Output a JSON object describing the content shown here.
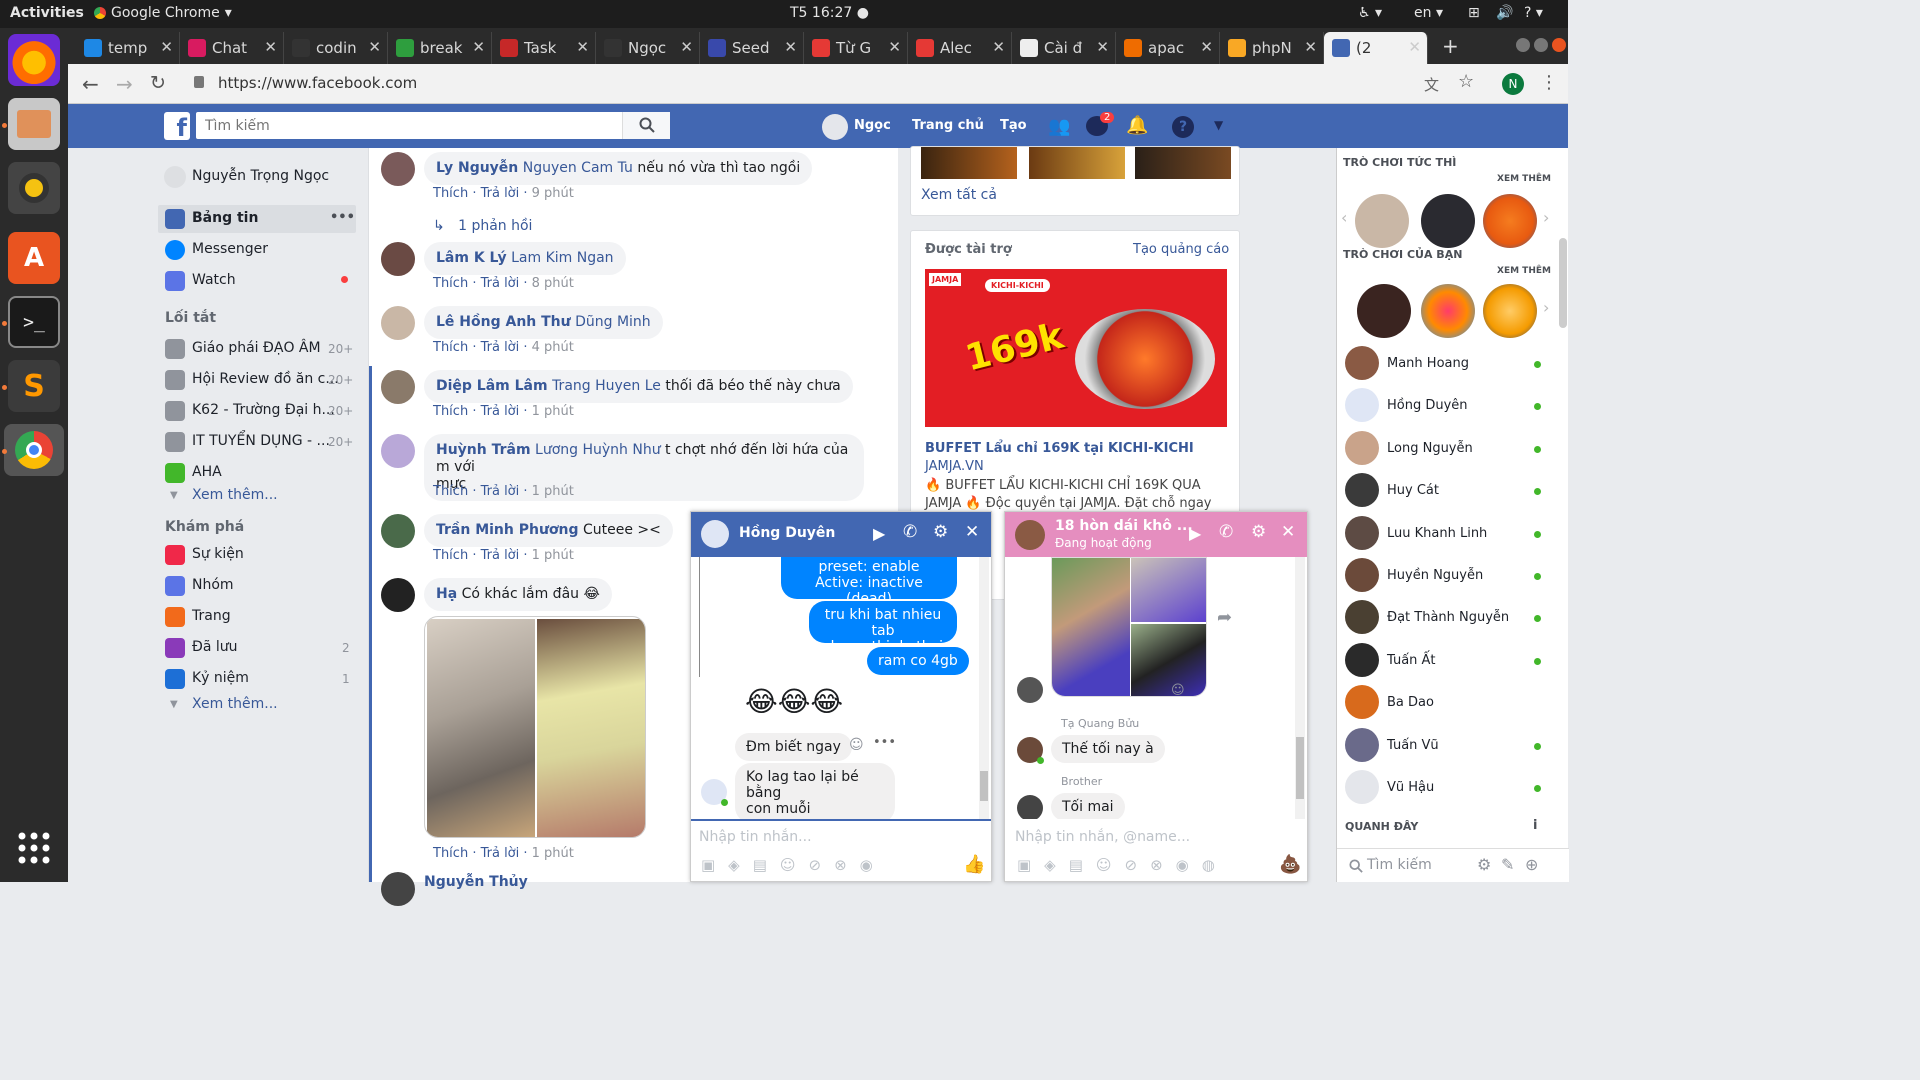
{
  "os": {
    "activities": "Activities",
    "app_menu": "Google Chrome",
    "clock": "T5 16:27",
    "lang": "en"
  },
  "tabs": [
    {
      "label": "temp",
      "color": "#1e88e5"
    },
    {
      "label": "Chat",
      "color": "#d81b60"
    },
    {
      "label": "codin",
      "color": "#333333"
    },
    {
      "label": "break",
      "color": "#2e9e3e"
    },
    {
      "label": "Task",
      "color": "#c62828"
    },
    {
      "label": "Ngọc",
      "color": "#333333"
    },
    {
      "label": "Seed",
      "color": "#3949ab"
    },
    {
      "label": "Từ G",
      "color": "#e53935"
    },
    {
      "label": "Alec",
      "color": "#e53935"
    },
    {
      "label": "Cài đ",
      "color": "#eeeeee"
    },
    {
      "label": "apac",
      "color": "#ef6c00"
    },
    {
      "label": "phpN",
      "color": "#f9a825"
    },
    {
      "label": "(2",
      "color": "#4267b2"
    }
  ],
  "address": {
    "url": "https://www.facebook.com",
    "profile_initial": "N"
  },
  "fb_header": {
    "search_placeholder": "Tìm kiếm",
    "user": "Ngọc",
    "home": "Trang chủ",
    "create": "Tạo",
    "messages_badge": "2"
  },
  "left_nav": {
    "profile_name": "Nguyễn Trọng Ngọc",
    "main": [
      {
        "label": "Bảng tin",
        "more": "•••"
      },
      {
        "label": "Messenger"
      },
      {
        "label": "Watch"
      }
    ],
    "shortcuts_title": "Lối tắt",
    "shortcuts": [
      {
        "label": "Giáo phái ĐẠO ÂM",
        "count": "20+"
      },
      {
        "label": "Hội Review đồ ăn c...",
        "count": "20+"
      },
      {
        "label": "K62 - Trường Đại h...",
        "count": "20+"
      },
      {
        "label": "IT TUYỂN DỤNG - ...",
        "count": "20+"
      },
      {
        "label": "AHA",
        "count": ""
      }
    ],
    "see_more_1": "Xem thêm...",
    "explore_title": "Khám phá",
    "explore": [
      {
        "label": "Sự kiện",
        "count": ""
      },
      {
        "label": "Nhóm",
        "count": ""
      },
      {
        "label": "Trang",
        "count": ""
      },
      {
        "label": "Đã lưu",
        "count": "2"
      },
      {
        "label": "Kỷ niệm",
        "count": "1"
      }
    ],
    "see_more_2": "Xem thêm..."
  },
  "comments": {
    "like": "Thích",
    "reply": "Trả lời",
    "items": [
      {
        "name": "Ly Nguyễn",
        "tag": "Nguyen Cam Tu",
        "text": " nếu nó vừa thì tao ngồi",
        "time": "9 phút"
      },
      {
        "name": "Lâm K Lý",
        "tag": "Lam Kim Ngan",
        "text": "",
        "time": "8 phút"
      },
      {
        "name": "Lê Hồng Anh Thư",
        "tag": "Dũng Minh",
        "text": "",
        "time": "4 phút"
      },
      {
        "name": "Diệp Lâm Lâm",
        "tag": "Trang Huyen Le",
        "text": " thối đã béo thế này chưa",
        "time": "1 phút"
      },
      {
        "name": "Huỳnh Trâm",
        "tag": "Lương Huỳnh Như",
        "text": " t chợt nhớ đến lời hứa của m với",
        "text2": "mực",
        "time": "1 phút"
      },
      {
        "name": "Trần Minh Phương",
        "tag": "",
        "text": " Cuteee ><",
        "time": "1 phút"
      },
      {
        "name": "Hạ",
        "tag": "",
        "text": " Có khác lắm đâu 😂",
        "time": "1 phút"
      }
    ],
    "replies": "1 phản hồi",
    "next_name": "Nguyễn Thủy"
  },
  "right": {
    "see_all": "Xem tất cả",
    "sponsored": "Được tài trợ",
    "create_ad": "Tạo quảng cáo",
    "ad_title": "BUFFET Lẩu chỉ 169K tại KICHI-KICHI",
    "ad_domain": "JAMJA.VN",
    "ad_text1": "🔥 BUFFET LẨU KICHI-KICHI CHỈ 169K QUA",
    "ad_text2": "JAMJA 🔥 Độc quyền tại JAMJA. Đặt chỗ ngay",
    "ad_price": "169k",
    "ad_brand": "KICHI-KICHI",
    "ad_logo": "JAMJA"
  },
  "sidebar": {
    "instant_games": "TRÒ CHƠI TỨC THÌ",
    "see_more": "XEM THÊM",
    "friends_games": "TRÒ CHƠI CỦA BẠN",
    "friends": [
      {
        "name": "Manh Hoang",
        "online": true,
        "color": "#8a5a44"
      },
      {
        "name": "Hồng Duyên",
        "online": true,
        "color": "#dfe6f5"
      },
      {
        "name": "Long Nguyễn",
        "online": true,
        "color": "#c9a38a"
      },
      {
        "name": "Huy Cát",
        "online": true,
        "color": "#3a3a3a"
      },
      {
        "name": "Luu Khanh Linh",
        "online": true,
        "color": "#5d4b44"
      },
      {
        "name": "Huyền Nguyễn",
        "online": true,
        "color": "#6b4a3a"
      },
      {
        "name": "Đạt Thành Nguyễn",
        "online": true,
        "color": "#4a4032"
      },
      {
        "name": "Tuấn Ất",
        "online": true,
        "color": "#2a2a2a"
      },
      {
        "name": "Ba Dao",
        "online": false,
        "color": "#d86a1c"
      },
      {
        "name": "Tuấn Vũ",
        "online": true,
        "color": "#6a6a8a"
      },
      {
        "name": "Vũ Hậu",
        "online": true,
        "color": "#e4e6eb"
      }
    ],
    "recent": "QUANH ĐÂY",
    "search_placeholder": "Tìm kiếm"
  },
  "chat1": {
    "name": "Hồng Duyên",
    "msgs_me": [
      "preset: enable",
      "Active: inactive (dead)",
      "tru khi bat nhieu tab",
      "chrom thi do thoi",
      "ram co 4gb"
    ],
    "emoji": "😂😂😂",
    "msgs_them": [
      "Đm biết ngay",
      "Ko lag tao lại bé bằng",
      "con muỗi"
    ],
    "input_placeholder": "Nhập tin nhắn..."
  },
  "chat2": {
    "name": "18 hòn dái khô ...",
    "status": "Đang hoạt động",
    "sender1": "Tạ Quang Bửu",
    "msg1": "Thế tối nay à",
    "sender2": "Brother",
    "msg2": "Tối mai",
    "input_placeholder": "Nhập tin nhắn, @name..."
  },
  "colors": {
    "fb_blue": "#4267b2",
    "messenger_blue": "#0084ff",
    "group_pink": "#e58ebf",
    "online": "#42b72a"
  }
}
